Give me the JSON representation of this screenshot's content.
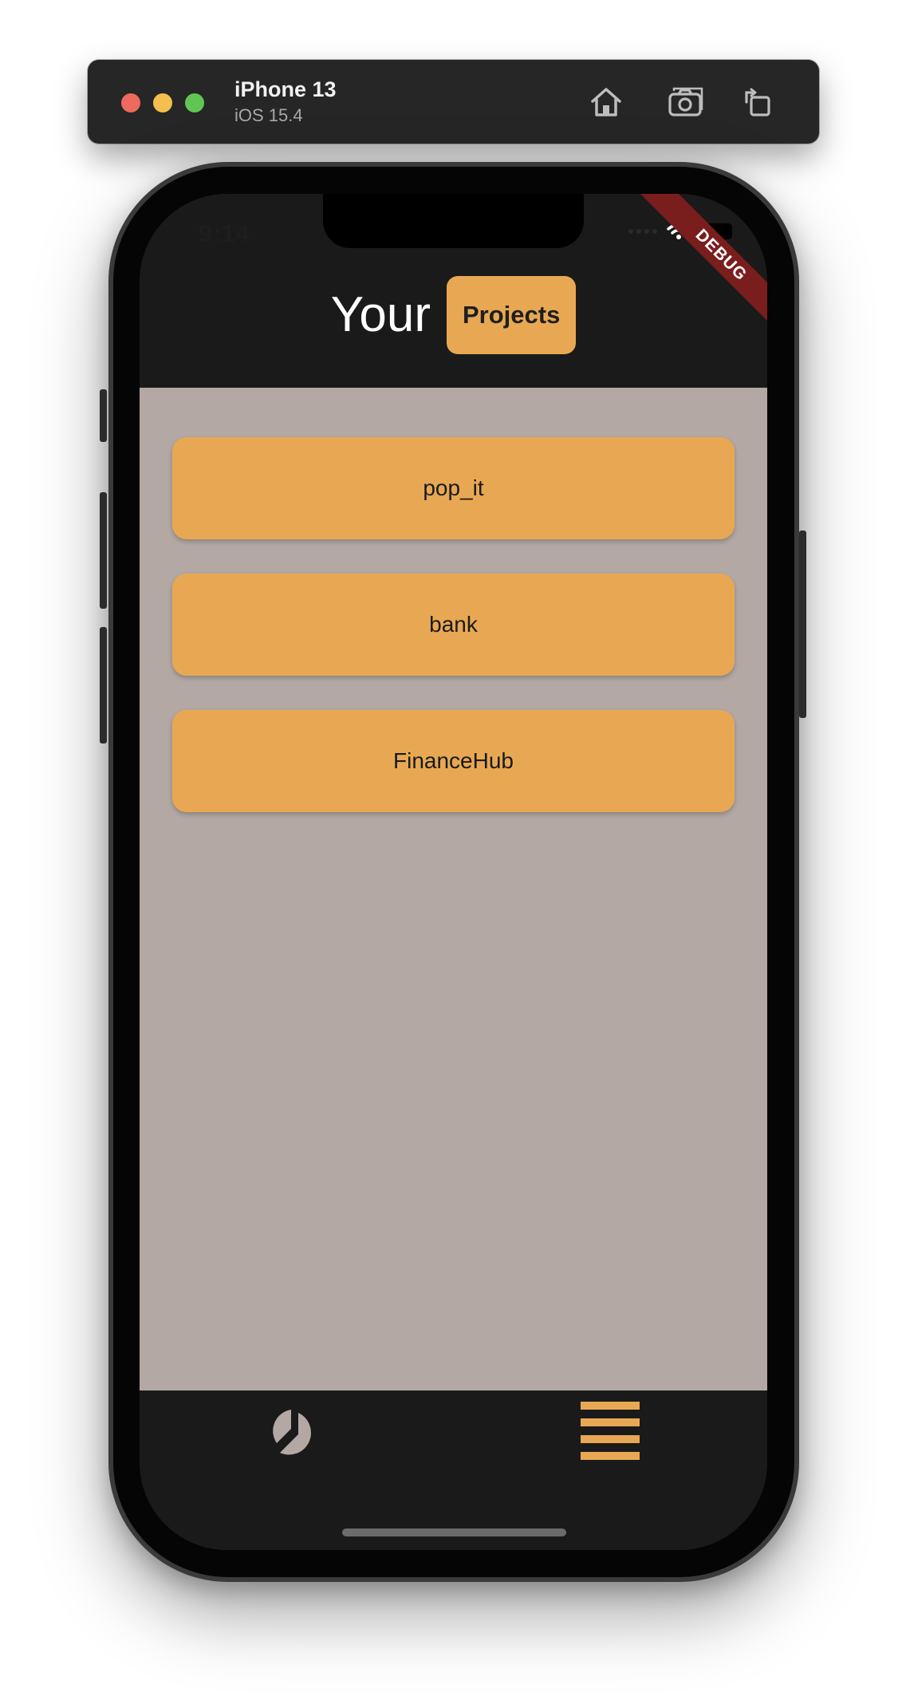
{
  "simulator": {
    "device_name": "iPhone 13",
    "os_version": "iOS 15.4",
    "toolbar_icons": [
      "home-icon",
      "screenshot-icon",
      "rotate-icon"
    ]
  },
  "status_bar": {
    "time": "9:14",
    "icons": [
      "wifi-icon",
      "battery-icon"
    ]
  },
  "debug_banner": "DEBUG",
  "header": {
    "title": "Your",
    "badge": "Projects"
  },
  "projects": [
    {
      "name": "pop_it"
    },
    {
      "name": "bank"
    },
    {
      "name": "FinanceHub"
    }
  ],
  "bottom_nav": {
    "items": [
      {
        "icon": "pie-chart-icon",
        "active": false
      },
      {
        "icon": "menu-lines-icon",
        "active": true
      }
    ]
  },
  "colors": {
    "accent": "#e8a853",
    "header_bg": "#1a1a1a",
    "content_bg": "#b3a8a3",
    "debug_banner": "#7a1d1d",
    "inactive_icon": "#b3a8a3"
  }
}
